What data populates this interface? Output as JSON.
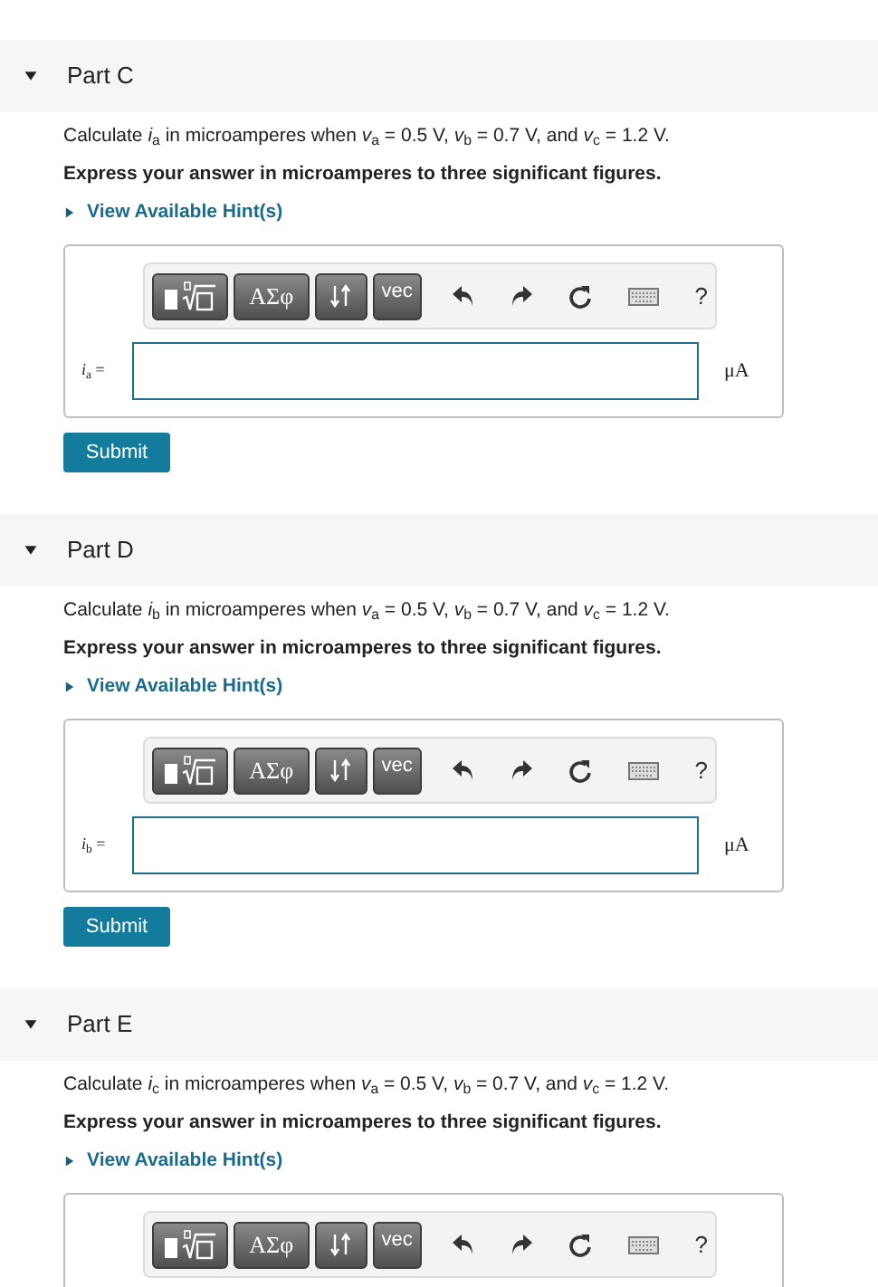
{
  "parts": [
    {
      "title": "Part C",
      "expanded": true,
      "question": "Calculate *i*$_{a}$ in microamperes when *v*$_{a}$ = 0.5 V, *v*$_{b}$ = 0.7 V, and *v*$_{c}$ = 1.2 V.",
      "instruction": "Express your answer in microamperes to three significant figures.",
      "hint_link": "View Available Hint(s)",
      "toolbar": {
        "greek": "ΑΣφ",
        "vec": "vec",
        "help": "?"
      },
      "answer": {
        "label": "*i*$_{a}$ =",
        "unit": "μA"
      },
      "submit": "Submit"
    },
    {
      "title": "Part D",
      "expanded": true,
      "question": "Calculate *i*$_{b}$ in microamperes when *v*$_{a}$ = 0.5 V, *v*$_{b}$ = 0.7 V, and *v*$_{c}$ = 1.2 V.",
      "instruction": "Express your answer in microamperes to three significant figures.",
      "hint_link": "View Available Hint(s)",
      "toolbar": {
        "greek": "ΑΣφ",
        "vec": "vec",
        "help": "?"
      },
      "answer": {
        "label": "*i*$_{b}$ =",
        "unit": "μA"
      },
      "submit": "Submit"
    },
    {
      "title": "Part E",
      "expanded": true,
      "question": "Calculate *i*$_{c}$ in microamperes when *v*$_{a}$ = 0.5 V, *v*$_{b}$ = 0.7 V, and *v*$_{c}$ = 1.2 V.",
      "instruction": "Express your answer in microamperes to three significant figures.",
      "hint_link": "View Available Hint(s)",
      "toolbar": {
        "greek": "ΑΣφ",
        "vec": "vec",
        "help": "?"
      }
    }
  ]
}
